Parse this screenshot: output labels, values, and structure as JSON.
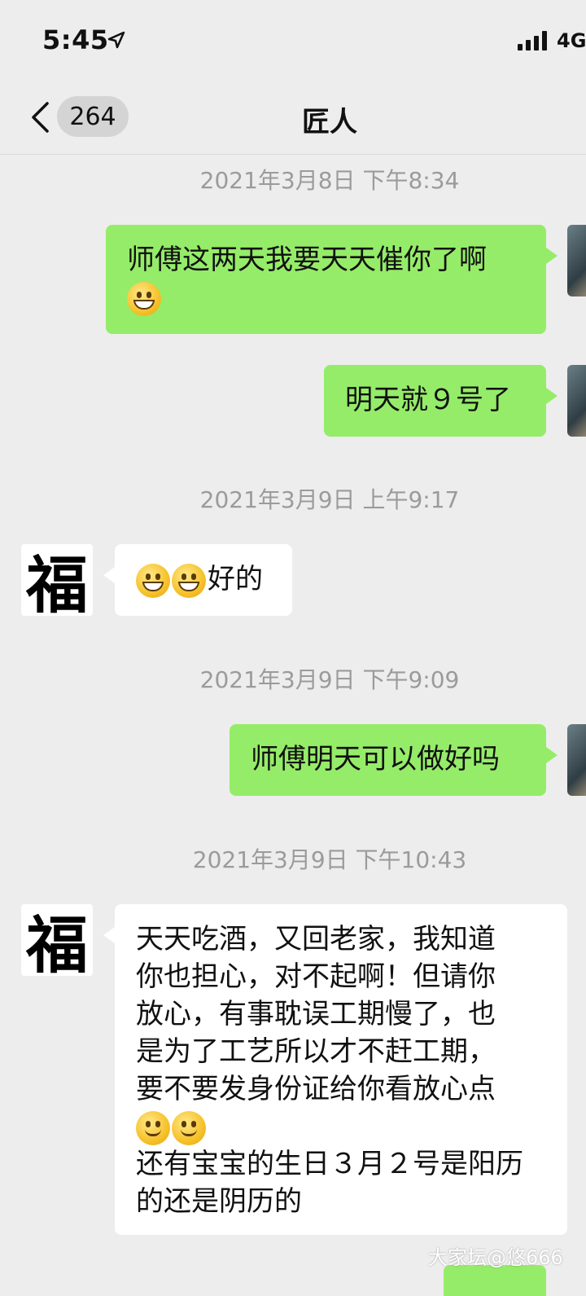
{
  "status_bar": {
    "time": "5:45",
    "network": "4G"
  },
  "nav": {
    "unread_count": "264",
    "title": "匠人"
  },
  "messages": {
    "ts1": "2021年3月8日 下午8:34",
    "m1_text": "师傅这两天我要天天催你了啊",
    "m2_text": "明天就９号了",
    "ts2": "2021年3月9日 上午9:17",
    "m3_text": "好的",
    "ts3": "2021年3月9日 下午9:09",
    "m4_text": "师傅明天可以做好吗",
    "ts4": "2021年3月9日 下午10:43",
    "m5_text_a": "天天吃酒，又回老家，我知道\n你也担心，对不起啊！但请你\n放心，有事耽误工期慢了，也\n是为了工艺所以才不赶工期，\n要不要发身份证给你看放心点",
    "m5_text_b": "还有宝宝的生日３月２号是阳历\n的还是阴历的"
  },
  "avatar": {
    "glyph": "福"
  },
  "watermark": "大家坛@悠666",
  "colors": {
    "sent_bubble": "#95ec69",
    "recv_bubble": "#ffffff",
    "background": "#ededed",
    "timestamp": "#9b9b9b"
  },
  "icons": [
    "location-arrow-icon",
    "signal-bars-icon",
    "back-chevron-icon",
    "grin-emoji-icon",
    "smile-emoji-icon"
  ]
}
